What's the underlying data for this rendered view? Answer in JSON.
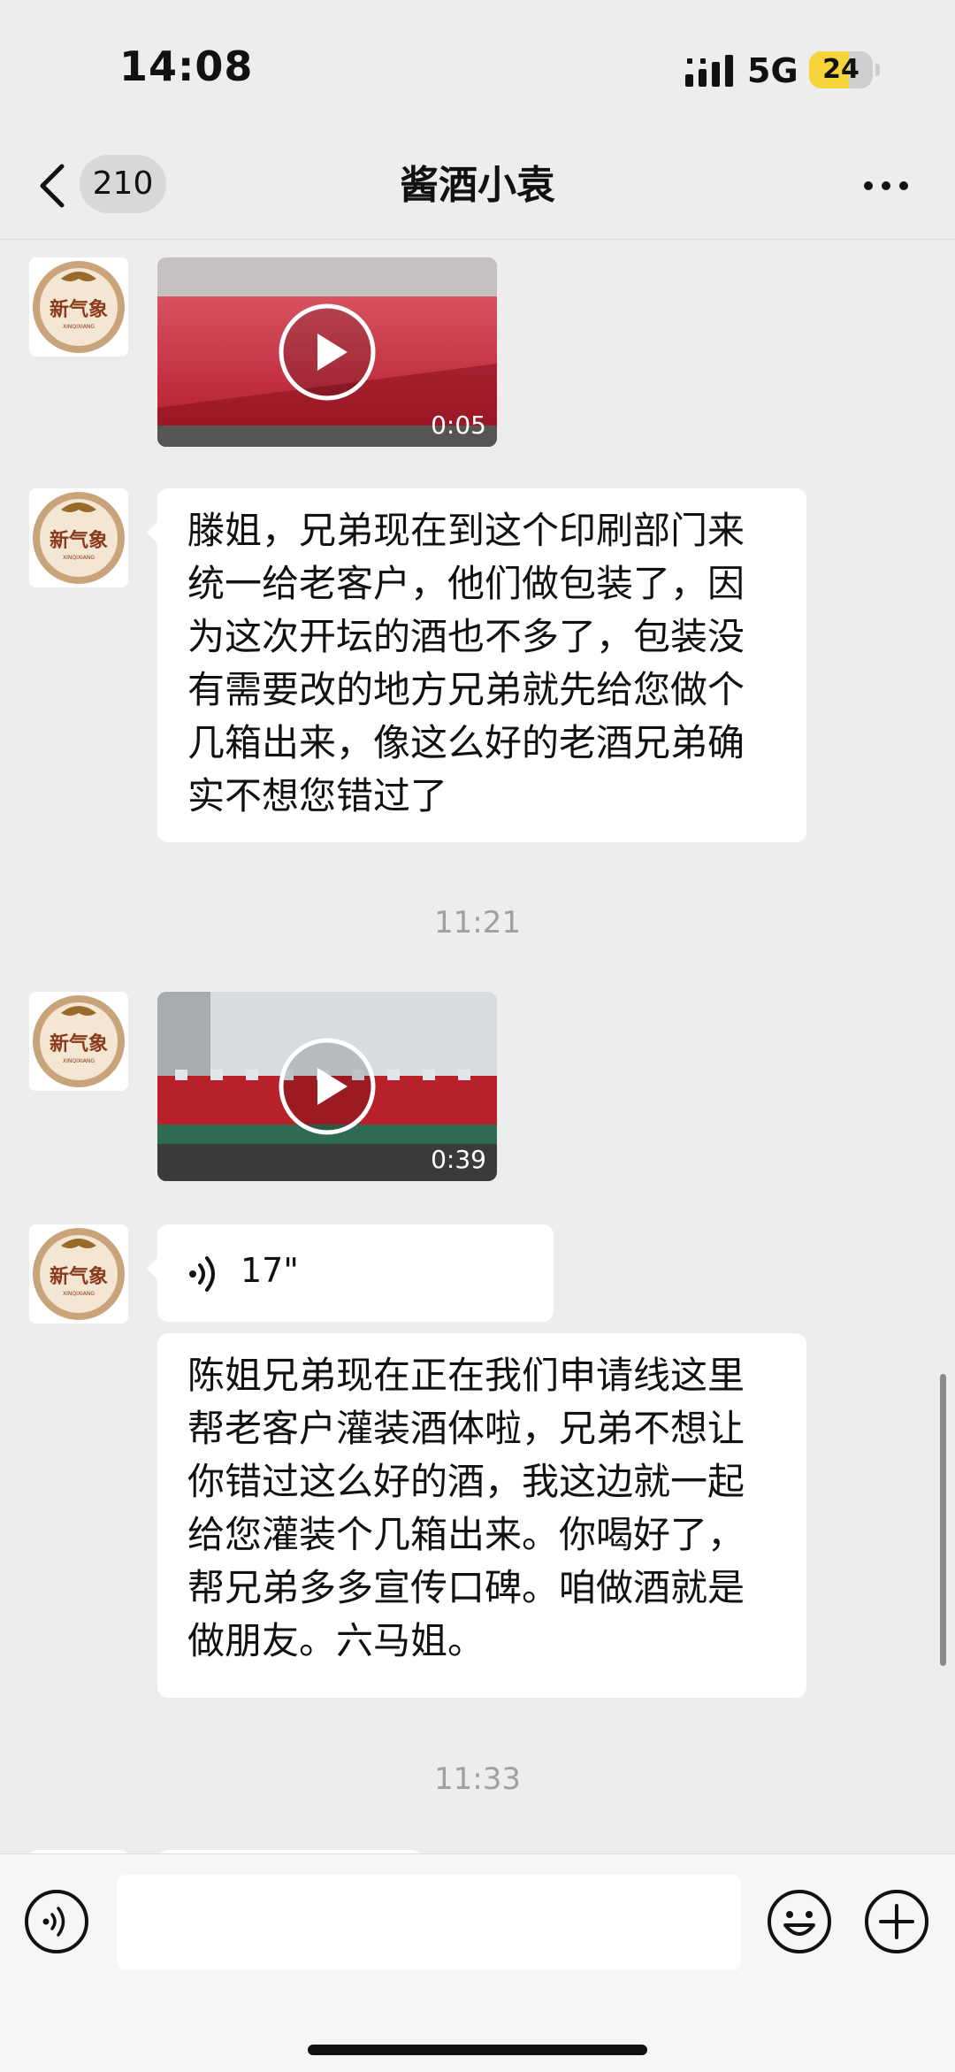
{
  "status_bar": {
    "time": "14:08",
    "network": "5G",
    "battery": "24",
    "battery_level": 0.24
  },
  "nav": {
    "unread_count": "210",
    "title": "酱酒小袁"
  },
  "avatar": {
    "brand_text": "新气象",
    "brand_sub": "XINQIXIANG"
  },
  "messages": [
    {
      "type": "video",
      "duration": "0:05"
    },
    {
      "type": "text",
      "text": "滕姐，兄弟现在到这个印刷部门来统一给老客户，他们做包装了，因为这次开坛的酒也不多了，包装没有需要改的地方兄弟就先给您做个几箱出来，像这么好的老酒兄弟确实不想您错过了"
    },
    {
      "type": "time",
      "text": "11:21"
    },
    {
      "type": "video",
      "duration": "0:39"
    },
    {
      "type": "voice",
      "length": "17\""
    },
    {
      "type": "text",
      "text": "陈姐兄弟现在正在我们申请线这里帮老客户灌装酒体啦，兄弟不想让你错过这么好的酒，我这边就一起给您灌装个几箱出来。你喝好了，帮兄弟多多宣传口碑。咱做酒就是做朋友。六马姐。"
    },
    {
      "type": "time",
      "text": "11:33"
    }
  ],
  "input": {
    "value": "",
    "placeholder": ""
  },
  "colors": {
    "background": "#ededed",
    "bubble": "#ffffff",
    "battery": "#f5d33a",
    "avatar_ring": "#9a6a2a"
  }
}
